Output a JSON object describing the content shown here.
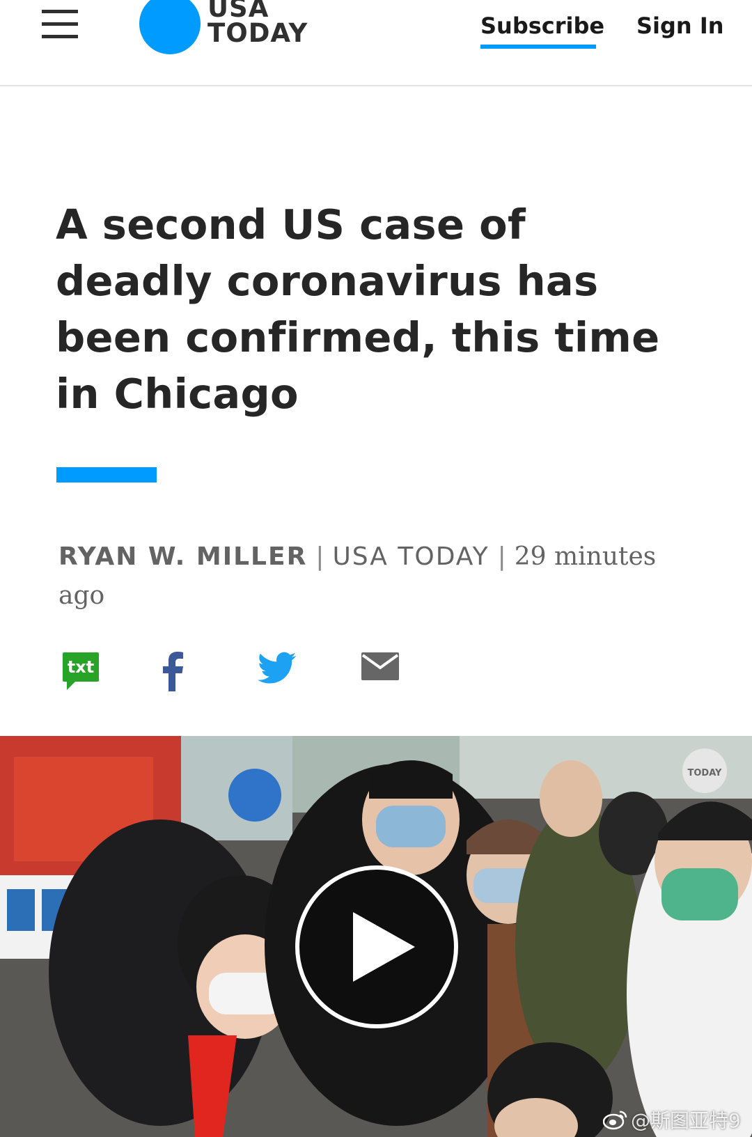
{
  "header": {
    "brand_line1": "USA",
    "brand_line2": "TODAY",
    "subscribe_label": "Subscribe",
    "signin_label": "Sign In"
  },
  "article": {
    "headline": "A second US case of deadly coronavirus has been confirmed, this time in Chicago",
    "byline": {
      "author": "RYAN W. MILLER",
      "source": "USA TODAY",
      "time": "29 minutes ago"
    }
  },
  "share": {
    "txt_label": "txt",
    "icons": [
      "sms-share-icon",
      "facebook-icon",
      "twitter-icon",
      "email-icon"
    ]
  },
  "video": {
    "overlay_logo_text": "TODAY",
    "watermark": "@斯图亚特9"
  },
  "colors": {
    "brand_blue": "#009bff",
    "text_dark": "#262626",
    "byline_gray": "#636363",
    "sms_green": "#27a327",
    "facebook_blue": "#3b5998",
    "twitter_blue": "#1da1f2",
    "mail_gray": "#666666"
  }
}
